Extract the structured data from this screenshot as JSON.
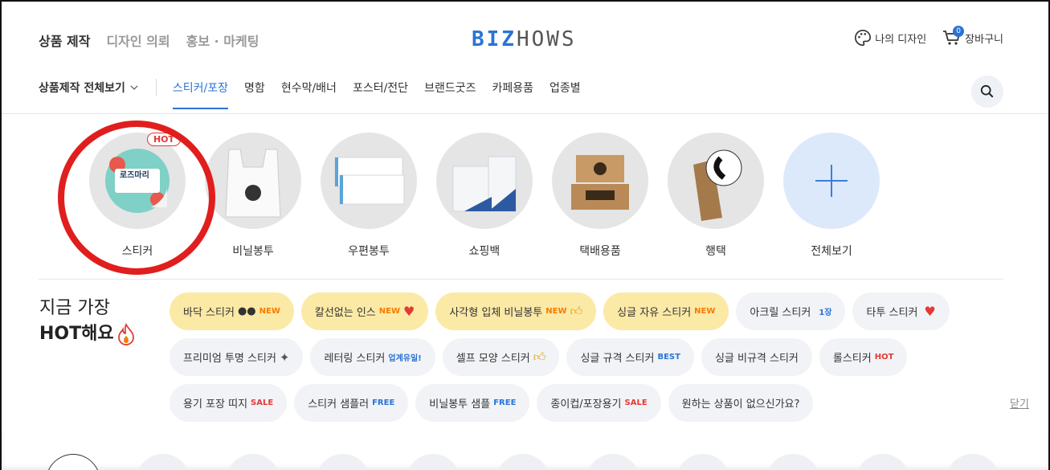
{
  "header": {
    "nav": [
      "상품 제작",
      "디자인 의뢰",
      "홍보 · 마케팅"
    ],
    "logo": {
      "part1": "BIZ",
      "part2": "HOWS"
    },
    "my_design": "나의 디자인",
    "cart": "장바구니",
    "cart_count": "0"
  },
  "catnav": {
    "all_label": "상품제작 전체보기",
    "tabs": [
      "스티커/포장",
      "명함",
      "현수막/배너",
      "포스터/전단",
      "브랜드굿즈",
      "카페용품",
      "업종별"
    ]
  },
  "products": {
    "items": [
      "스티커",
      "비닐봉투",
      "우편봉투",
      "쇼핑백",
      "택배용품",
      "행택",
      "전체보기"
    ],
    "hot_tag": "HOT",
    "sticker_text": "로즈마리"
  },
  "hot": {
    "title_line1": "지금 가장",
    "title_line2": "HOT해요",
    "chips": [
      {
        "label": "바닥 스티커",
        "badge": "NEW",
        "icon": "eyes-icon"
      },
      {
        "label": "칼선없는 인스",
        "badge": "NEW",
        "icon": "heart-icon"
      },
      {
        "label": "사각형 입체 비닐봉투",
        "badge": "NEW",
        "icon": "thumbs-up-icon"
      },
      {
        "label": "싱글 자유 스티커",
        "badge": "NEW"
      },
      {
        "label": "아크릴 스티커",
        "badge": "1장"
      },
      {
        "label": "타투 스티커",
        "icon": "heart-icon"
      },
      {
        "label": "프리미엄 투명 스티커",
        "icon": "sparkle-icon"
      },
      {
        "label": "레터링 스티커",
        "badge": "업계유일!"
      },
      {
        "label": "셀프 모양 스티커",
        "icon": "thumbs-up-icon"
      },
      {
        "label": "싱글 규격 스티커",
        "badge": "BEST"
      },
      {
        "label": "싱글 비규격 스티커"
      },
      {
        "label": "롤스티커",
        "badge": "HOT"
      },
      {
        "label": "용기 포장 띠지",
        "badge": "SALE"
      },
      {
        "label": "스티커 샘플러",
        "badge": "FREE"
      },
      {
        "label": "비닐봉투 샘플",
        "badge": "FREE"
      },
      {
        "label": "종이컵/포장용기",
        "badge": "SALE"
      },
      {
        "label": "원하는 상품이 없으신가요?"
      }
    ],
    "close": "닫기"
  },
  "colors": {
    "accent": "#2a73d6",
    "highlight_chip": "#fbe9a6",
    "chip": "#f1f3f6",
    "annotation_ring": "#e01e1e"
  }
}
